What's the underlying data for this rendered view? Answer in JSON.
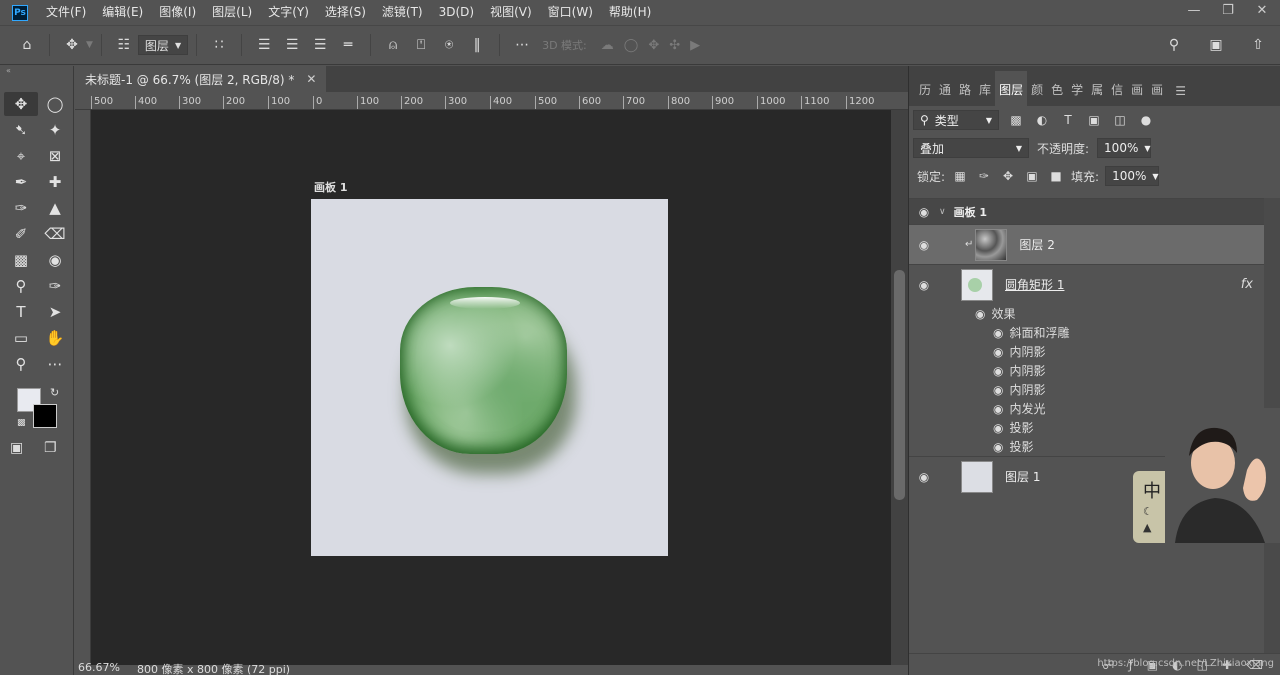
{
  "menu": {
    "logo": "Ps",
    "items": [
      "文件(F)",
      "编辑(E)",
      "图像(I)",
      "图层(L)",
      "文字(Y)",
      "选择(S)",
      "滤镜(T)",
      "3D(D)",
      "视图(V)",
      "窗口(W)",
      "帮助(H)"
    ]
  },
  "options": {
    "layer_select": "图层",
    "mode3d": "3D 模式:"
  },
  "document": {
    "tab_title": "未标题-1 @ 66.7% (图层 2, RGB/8) *",
    "artboard_name": "画板 1",
    "ruler_labels": [
      "500",
      "400",
      "300",
      "200",
      "100",
      "0",
      "100",
      "200",
      "300",
      "400",
      "500",
      "600",
      "700",
      "800",
      "900",
      "1000",
      "1100",
      "1200"
    ],
    "jade_color": "#6fab6a",
    "canvas_bg": "#282828",
    "artboard_bg": "#d9dbe3"
  },
  "status": {
    "zoom": "66.67%",
    "doc_info": "800 像素 x 800 像素 (72 ppi)"
  },
  "panel": {
    "tabs": [
      "历",
      "通",
      "路",
      "库",
      "图层",
      "颜",
      "色",
      "学",
      "属",
      "信",
      "画",
      "画"
    ],
    "filter_kind": "类型",
    "blend_mode": "叠加",
    "opacity_label": "不透明度:",
    "opacity_value": "100%",
    "lock_label": "锁定:",
    "fill_label": "填充:",
    "fill_value": "100%",
    "group_name": "画板 1",
    "layers": [
      {
        "name": "图层 2"
      },
      {
        "name": "圆角矩形 1",
        "fx": "fx"
      },
      {
        "name": "图层 1"
      }
    ],
    "effects_label": "效果",
    "effects": [
      "斜面和浮雕",
      "内阴影",
      "内阴影",
      "内阴影",
      "内发光",
      "投影",
      "投影"
    ],
    "watermark": "https://blog.csdn.net/LZhixiaoxiang"
  },
  "ime": {
    "char": "中"
  }
}
